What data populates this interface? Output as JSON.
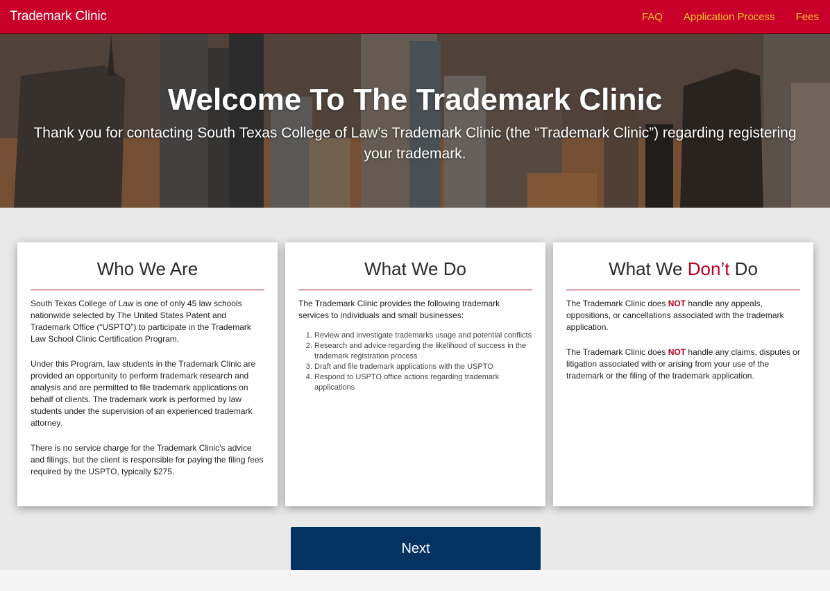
{
  "navbar": {
    "brand": "Trademark Clinic",
    "links": [
      "FAQ",
      "Application Process",
      "Fees"
    ]
  },
  "hero": {
    "title": "Welcome To The Trademark Clinic",
    "subtitle": "Thank you for contacting South Texas College of Law’s Trademark Clinic (the “Trademark Clinic”) regarding registering your trademark."
  },
  "cards": {
    "who": {
      "title": "Who We Are",
      "paragraphs": [
        "South Texas College of Law is one of only 45 law schools nationwide selected by The United States Patent and Trademark Office (“USPTO”) to participate in the Trademark Law School Clinic Certification Program.",
        "Under this Program, law students in the Trademark Clinic are provided an opportunity to perform trademark research and analysis and are permitted to file trademark applications on behalf of clients. The trademark work is performed by law students under the supervision of an experienced trademark attorney.",
        "There is no service charge for the Trademark Clinic’s advice and filings, but the client is responsible for paying the filing fees required by the USPTO, typically $275."
      ]
    },
    "what": {
      "title": "What We Do",
      "intro": "The Trademark Clinic provides the following trademark services to individuals and small businesses:",
      "items": [
        "Review and investigate trademarks usage and potential conflicts",
        "Research and advice regarding the likelihood of success in the trademark registration process",
        "Draft and file trademark applications with the USPTO",
        "Respond to USPTO office actions regarding trademark applications"
      ]
    },
    "dont": {
      "title_before": "What We ",
      "title_highlight": "Don’t",
      "title_after": " Do",
      "highlight_color": "#b8001f",
      "paragraphs": [
        {
          "before": "The Trademark Clinic does ",
          "emphasis": "NOT",
          "after": " handle any appeals, oppositions, or cancellations associated with the trademark application."
        },
        {
          "before": "The Trademark Clinic does ",
          "emphasis": "NOT",
          "after": " handle any claims, disputes or litigation associated with or arising from your use of the trademark or the filing of the trademark application."
        }
      ]
    }
  },
  "actions": {
    "next_label": "Next"
  },
  "colors": {
    "navbar": "#c8002a",
    "nav_link": "#f7c62a",
    "button": "#043261",
    "divider": "#a4001f"
  }
}
